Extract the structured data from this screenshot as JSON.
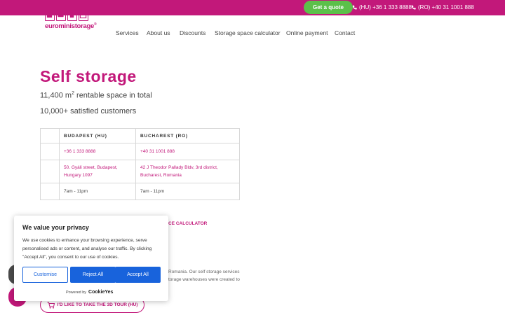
{
  "topbar": {
    "quote_label": "Get a quote",
    "phone_hu": "(HU) +36 1 333 8888",
    "phone_ro": "(RO) +40 31 1001 888",
    "color": "#c2187a"
  },
  "brand": {
    "name": "euroministorage",
    "mark": "®"
  },
  "nav": {
    "items": [
      "Services",
      "About us",
      "Discounts",
      "Storage space calculator",
      "Online payment",
      "Contact"
    ]
  },
  "hero": {
    "title": "Self storage",
    "stat_area_num": "11,400 m",
    "stat_area_sup": "2",
    "stat_area_rest": " rentable space in total",
    "stat_customers": "10,000+ satisfied customers"
  },
  "table": {
    "headers": [
      "BUDAPEST (HU)",
      "BUCHAREST (RO)"
    ],
    "phone": [
      "+36 1 333 8888",
      "+40 31 1001 888"
    ],
    "address_line1": [
      "50. Gyáli street, Budapest,",
      "42 J Theodor Pallady Bldv, 3rd district,"
    ],
    "address_line2": [
      "Hungary 1097",
      "Bucharest, Romania"
    ],
    "hours": [
      "7am - 11pm",
      "7am - 11pm"
    ]
  },
  "content": {
    "calculator_link": "CE CALCULATOR",
    "text_line1": "Romania. Our self storage services",
    "text_line2": "torage warehouses were created to",
    "tour_button": "I'D LIKE TO TAKE THE 3D TOUR (HU)"
  },
  "cookie": {
    "title": "We value your privacy",
    "text": "We use cookies to enhance your browsing experience, serve personalised ads or content, and analyse our traffic. By clicking \"Accept All\", you consent to our use of cookies.",
    "customise": "Customise",
    "reject": "Reject All",
    "accept": "Accept All",
    "powered_by": "Powered by",
    "powered_brand": "CookieYes",
    "accent": "#1863dc"
  }
}
